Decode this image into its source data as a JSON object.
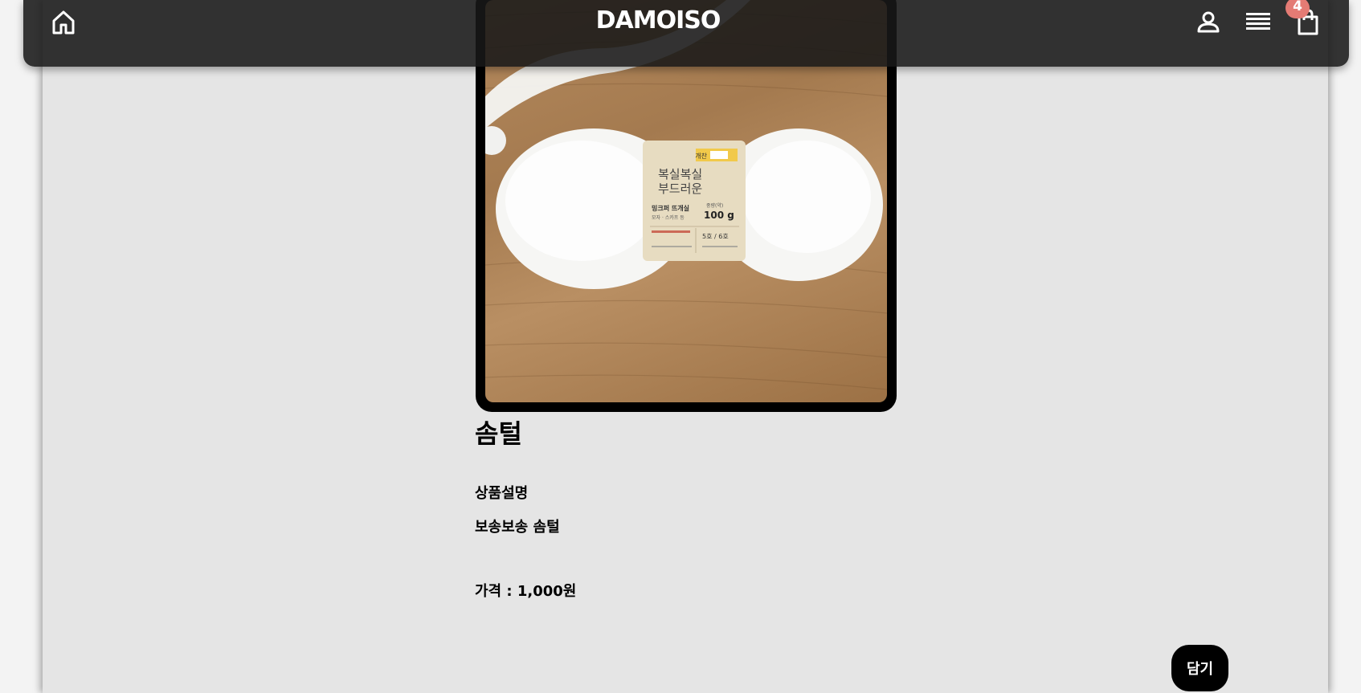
{
  "navbar": {
    "brand": "DAMOISO",
    "home_icon": "home-icon",
    "user_icon": "user-icon",
    "menu_icon": "menu-icon",
    "bag_icon": "shopping-bag-icon",
    "cart_count": "4",
    "badge_color": "#e47b74"
  },
  "product": {
    "title": "솜털",
    "description_label": "상품설명",
    "description": "보송보송 솜털",
    "price": "가격 : 1,000원",
    "image": {
      "package_line1": "복실복실",
      "package_line2": "부드러운",
      "package_brand": "밍크퍼 뜨개실",
      "package_sub": "모자 · 스카프 등",
      "package_weight_label": "중량(약)",
      "package_weight": "100 g",
      "package_tag": "개찬",
      "package_needle": "5호 / 6호"
    }
  },
  "actions": {
    "add_label": "담기"
  },
  "colors": {
    "page_bg": "#e5e5e5",
    "navbar_bg": "#181818",
    "button_bg": "#000000"
  }
}
